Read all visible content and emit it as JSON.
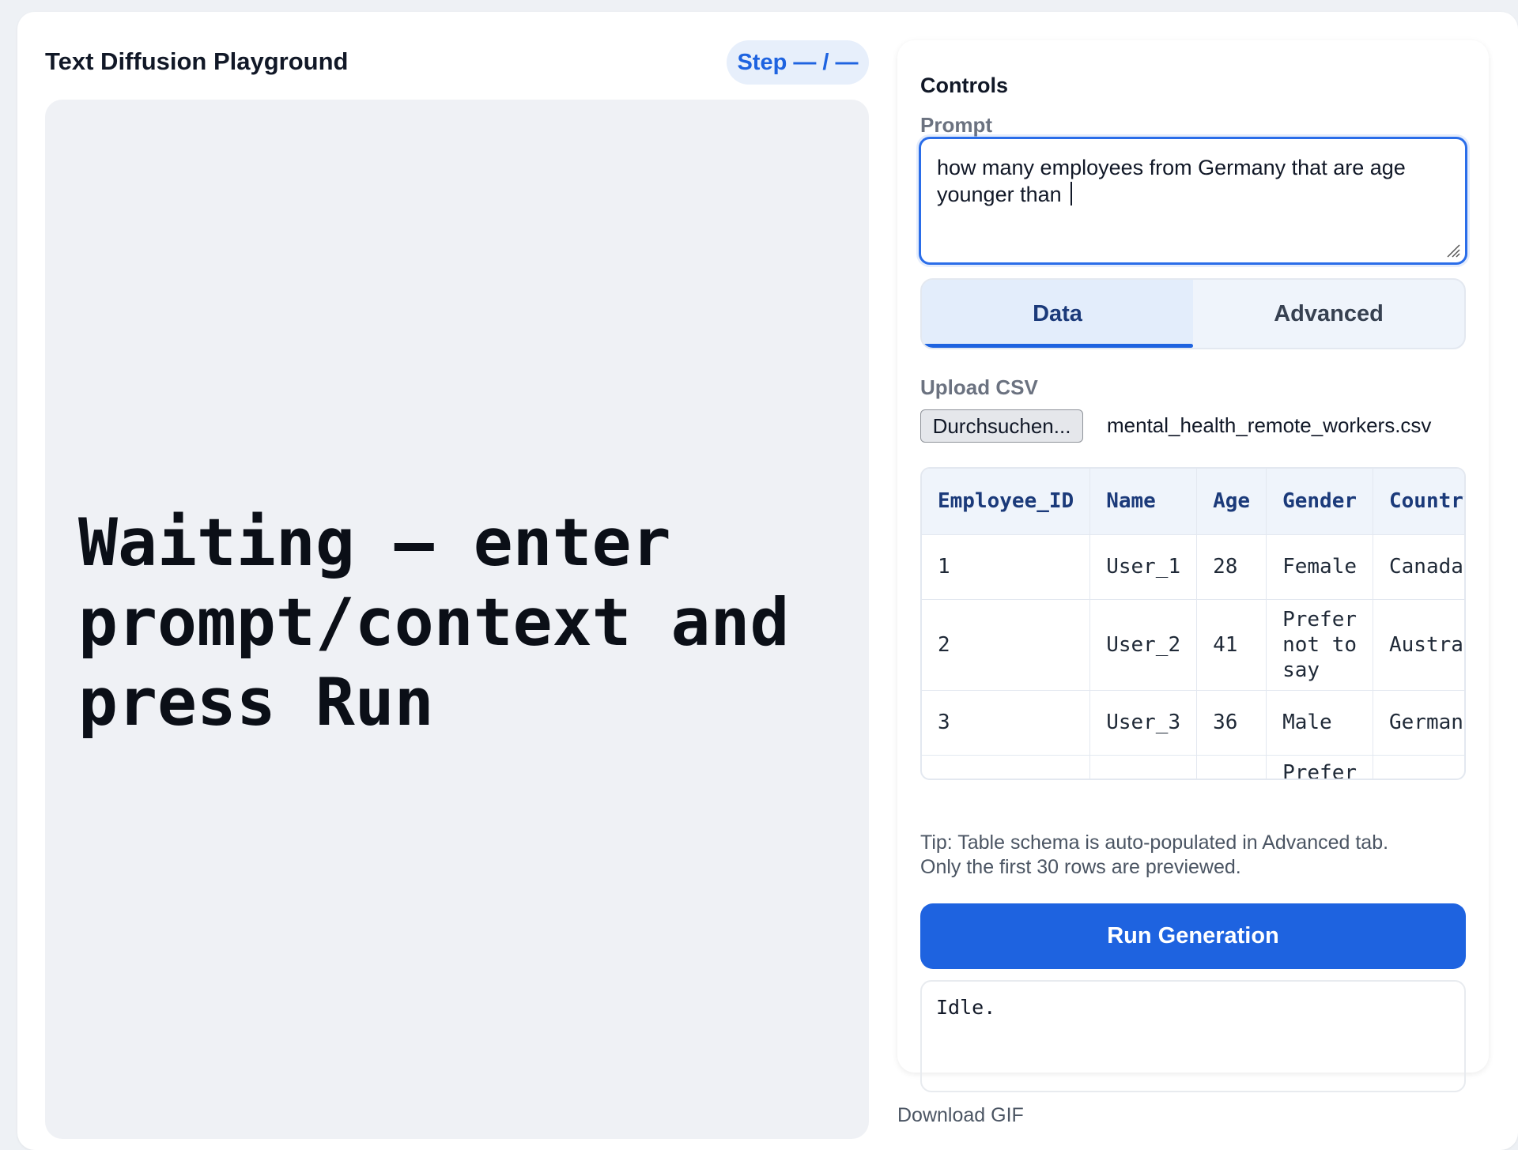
{
  "left_panel": {
    "title": "Text Diffusion Playground",
    "step_badge": "Step — / —",
    "canvas_message": "Waiting — enter prompt/context and press Run"
  },
  "controls": {
    "heading": "Controls",
    "prompt_label": "Prompt",
    "prompt_value": "how many employees from Germany that are age younger than ",
    "tabs": [
      {
        "label": "Data",
        "active": true
      },
      {
        "label": "Advanced",
        "active": false
      }
    ],
    "upload_label": "Upload CSV",
    "file_button": "Durchsuchen...",
    "file_name": "mental_health_remote_workers.csv",
    "table": {
      "columns": [
        "Employee_ID",
        "Name",
        "Age",
        "Gender",
        "Country"
      ],
      "rows": [
        [
          "1",
          "User_1",
          "28",
          "Female",
          "Canada"
        ],
        [
          "2",
          "User_2",
          "41",
          "Prefer not to say",
          "Australia"
        ],
        [
          "3",
          "User_3",
          "36",
          "Male",
          "Germany"
        ],
        [
          "",
          "",
          "",
          "Prefer",
          ""
        ]
      ]
    },
    "tip_line1": "Tip: Table schema is auto-populated in Advanced tab.",
    "tip_line2": "Only the first 30 rows are previewed.",
    "run_button": "Run Generation",
    "status": "Idle."
  },
  "download_link": "Download GIF",
  "colors": {
    "accent": "#1e63e0",
    "page_bg": "#eef1f5",
    "canvas_bg": "#eff1f5"
  }
}
